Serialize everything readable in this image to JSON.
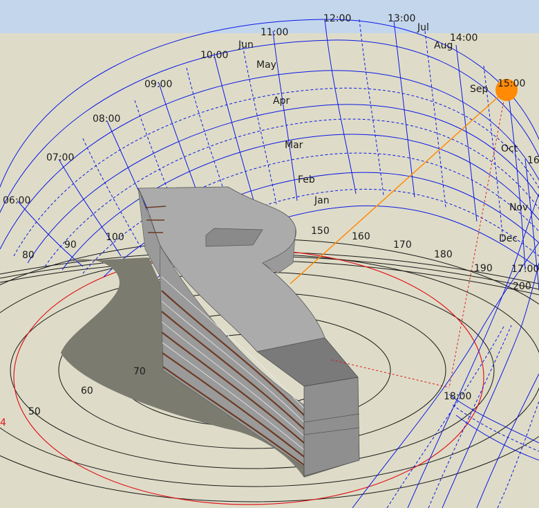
{
  "colors": {
    "sky": "#c4d6ec",
    "ground": "#dedcc8",
    "sunpath": "#0a17e6",
    "sun": "#ff8a05",
    "sunray": "#ff8a05",
    "shadow_line": "#e0161b",
    "building_roof": "#ababab",
    "building_wall": "#888888",
    "ground_shadow": "#7b7b70"
  },
  "hour_labels": [
    "06:00",
    "07:00",
    "08:00",
    "09:00",
    "10:00",
    "11:00",
    "12:00",
    "13:00",
    "14:00",
    "15:00",
    "16",
    "17:00",
    "18:00"
  ],
  "month_labels": [
    "Jun",
    "Jul",
    "May",
    "Aug",
    "Apr",
    "Sep",
    "Mar",
    "Oct",
    "Feb",
    "Jan",
    "Nov",
    "Dec"
  ],
  "azimuth_labels": [
    "80",
    "90",
    "100",
    "150",
    "160",
    "170",
    "180",
    "190",
    "200"
  ],
  "altitude_labels": [
    "70",
    "60",
    "50"
  ],
  "edge_label": "4",
  "sun_marker_icon": "sun-icon"
}
